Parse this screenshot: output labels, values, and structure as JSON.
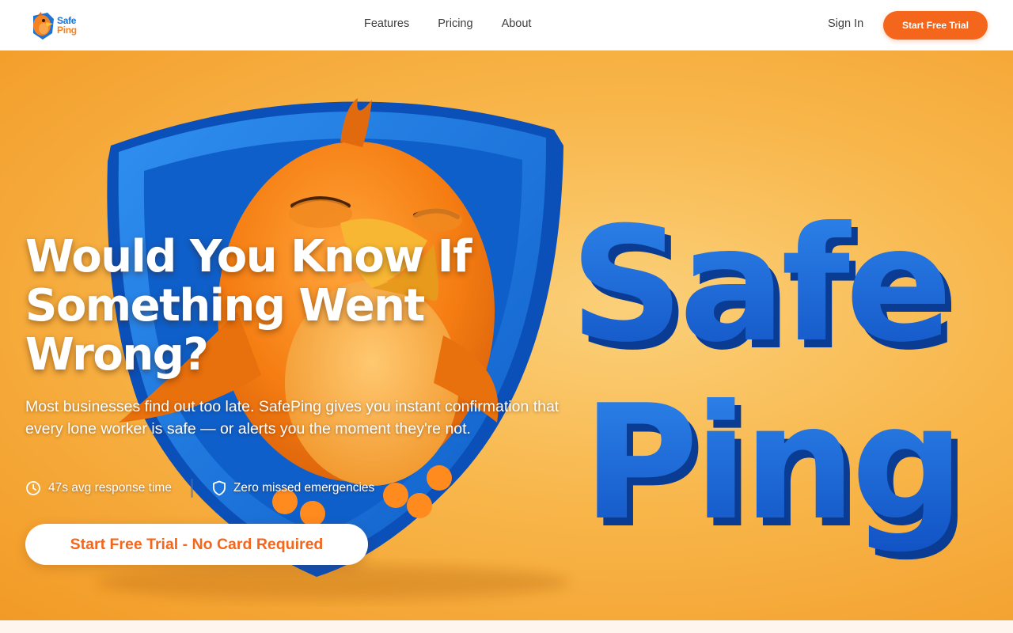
{
  "header": {
    "logo_text_top": "Safe",
    "logo_text_bottom": "Ping",
    "nav": [
      "Features",
      "Pricing",
      "About"
    ],
    "sign_in": "Sign In",
    "cta": "Start Free Trial"
  },
  "hero": {
    "title": "Would You Know If Something Went Wrong?",
    "subtitle": "Most businesses find out too late. SafePing gives you instant confirmation that every lone worker is safe — or alerts you the moment they're not.",
    "stats": [
      {
        "icon": "clock-icon",
        "text": "47s avg response time"
      },
      {
        "icon": "shield-icon",
        "text": "Zero missed emergencies"
      }
    ],
    "cta": "Start Free Trial - No Card Required",
    "art_text_top": "Safe",
    "art_text_bottom": "Ping"
  },
  "colors": {
    "accent": "#f4661c",
    "brand_blue": "#1a66d6",
    "hero_orange": "#f8b64a"
  }
}
